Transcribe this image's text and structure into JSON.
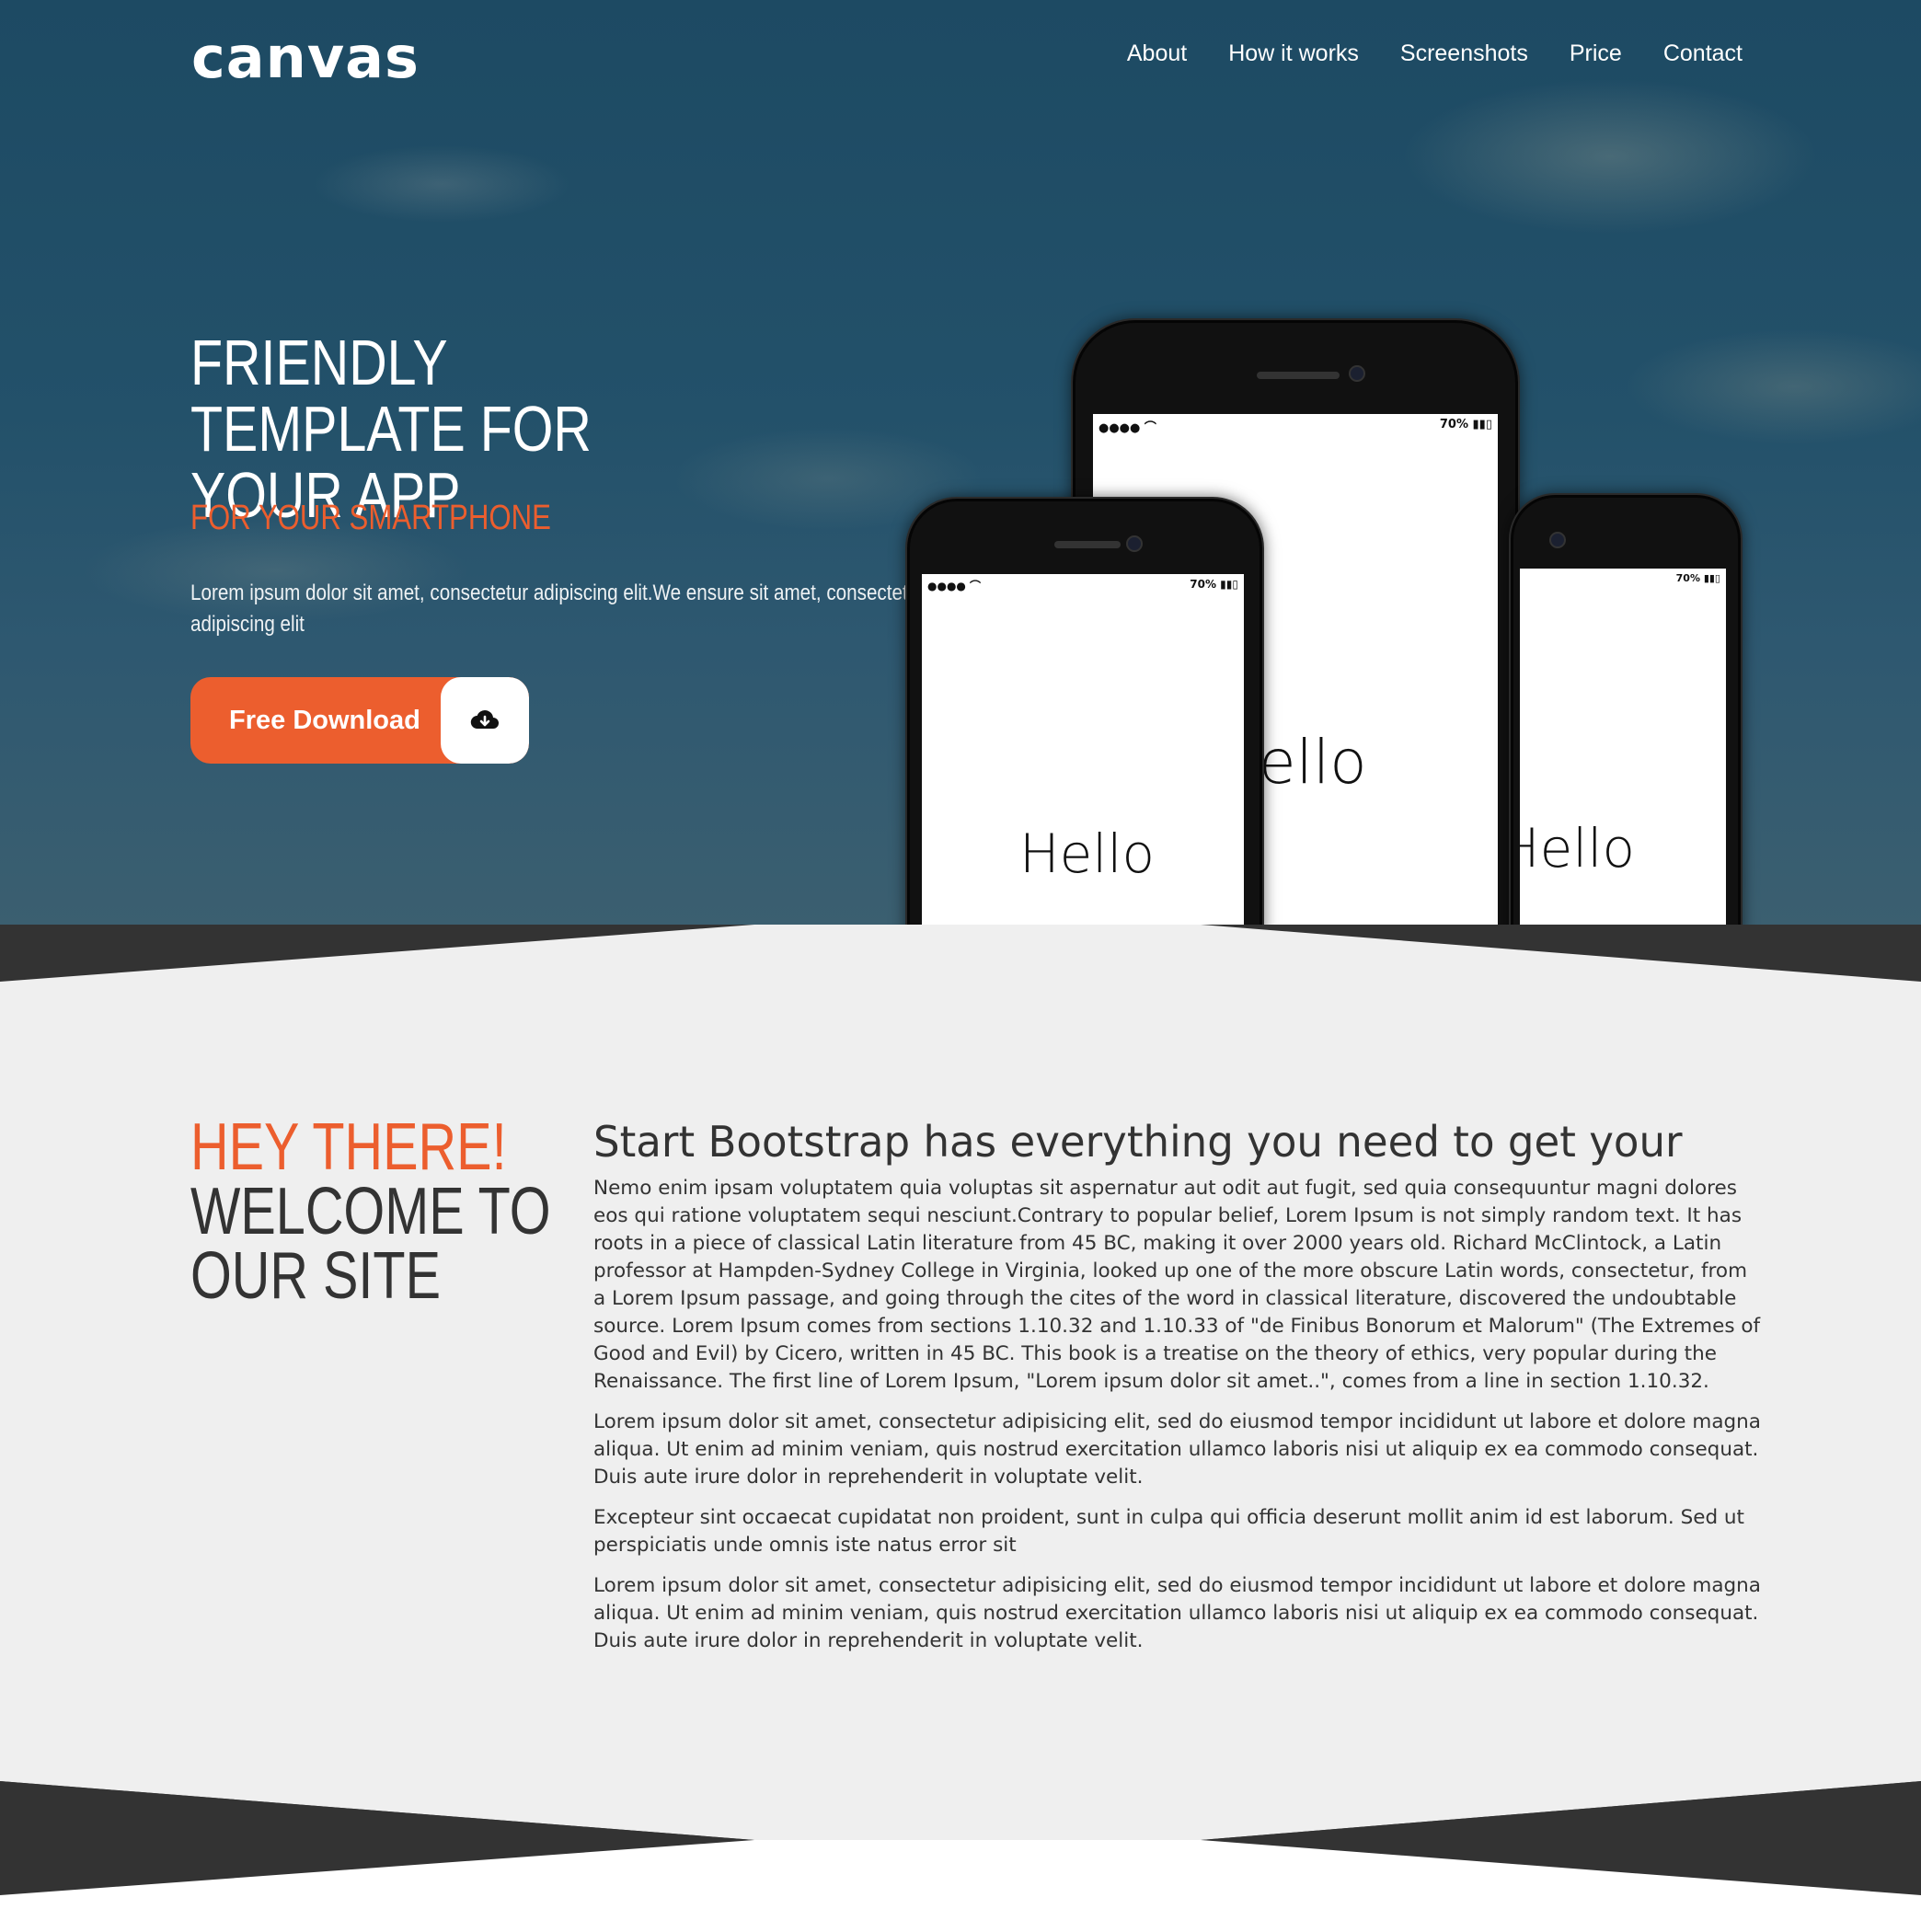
{
  "brand": {
    "logo": "canvas"
  },
  "nav": {
    "items": [
      "About",
      "How it works",
      "Screenshots",
      "Price",
      "Contact"
    ]
  },
  "hero": {
    "title": "FRIENDLY TEMPLATE FOR YOUR APP",
    "subtitle": "FOR YOUR SMARTPHONE",
    "text": "Lorem ipsum dolor sit amet, consectetur adipiscing elit.We ensure sit amet, consectetur adipiscing elit",
    "cta_label": "Free Download",
    "cta_icon": "cloud-download-icon"
  },
  "phones": {
    "battery": "70%",
    "hello_front": "Hello",
    "hello_center": "ello",
    "hello_right": "Hello"
  },
  "about": {
    "heading_accent": "HEY THERE!",
    "heading_line2": "WELCOME TO",
    "heading_line3": "OUR SITE",
    "title": "Start Bootstrap has everything you need to get your",
    "paragraphs": [
      "Nemo enim ipsam voluptatem quia voluptas sit aspernatur aut odit aut fugit, sed quia consequuntur magni dolores eos qui ratione voluptatem sequi nesciunt.Contrary to popular belief, Lorem Ipsum is not simply random text. It has roots in a piece of classical Latin literature from 45 BC, making it over 2000 years old. Richard McClintock, a Latin professor at Hampden-Sydney College in Virginia, looked up one of the more obscure Latin words, consectetur, from a Lorem Ipsum passage, and going through the cites of the word in classical literature, discovered the undoubtable source. Lorem Ipsum comes from sections 1.10.32 and 1.10.33 of \"de Finibus Bonorum et Malorum\" (The Extremes of Good and Evil) by Cicero, written in 45 BC. This book is a treatise on the theory of ethics, very popular during the Renaissance. The first line of Lorem Ipsum, \"Lorem ipsum dolor sit amet..\", comes from a line in section 1.10.32.",
      "Lorem ipsum dolor sit amet, consectetur adipisicing elit, sed do eiusmod tempor incididunt ut labore et dolore magna aliqua. Ut enim ad minim veniam, quis nostrud exercitation ullamco laboris nisi ut aliquip ex ea commodo consequat. Duis aute irure dolor in reprehenderit in voluptate velit.",
      "Excepteur sint occaecat cupidatat non proident, sunt in culpa qui officia deserunt mollit anim id est laborum. Sed ut perspiciatis unde omnis iste natus error sit",
      "Lorem ipsum dolor sit amet, consectetur adipisicing elit, sed do eiusmod tempor incididunt ut labore et dolore magna aliqua. Ut enim ad minim veniam, quis nostrud exercitation ullamco laboris nisi ut aliquip ex ea commodo consequat. Duis aute irure dolor in reprehenderit in voluptate velit."
    ]
  },
  "colors": {
    "accent": "#ec5e2e",
    "dark": "#333333",
    "light_bg": "#efefef"
  }
}
